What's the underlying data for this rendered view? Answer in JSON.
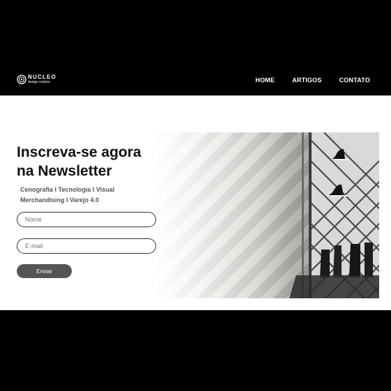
{
  "brand": {
    "name": "NUCLEO",
    "tagline": "design criativo"
  },
  "nav": {
    "items": [
      {
        "label": "HOME"
      },
      {
        "label": "ARTIGOS"
      },
      {
        "label": "CONTATO"
      }
    ]
  },
  "newsletter": {
    "title_line1": "Inscreva-se agora",
    "title_line2": "na Newsletter",
    "subtitle_line1": "Cenografia I Tecnologia I Visual",
    "subtitle_line2": "Merchandising I Varejo 4.0",
    "name_placeholder": "Nome",
    "email_placeholder": "E-mail",
    "submit_label": "Enviar"
  },
  "colors": {
    "header_bg": "#000000",
    "content_bg": "#ffffff",
    "button_bg": "#555555"
  },
  "icons": {
    "logo": "concentric-circle-mark"
  }
}
